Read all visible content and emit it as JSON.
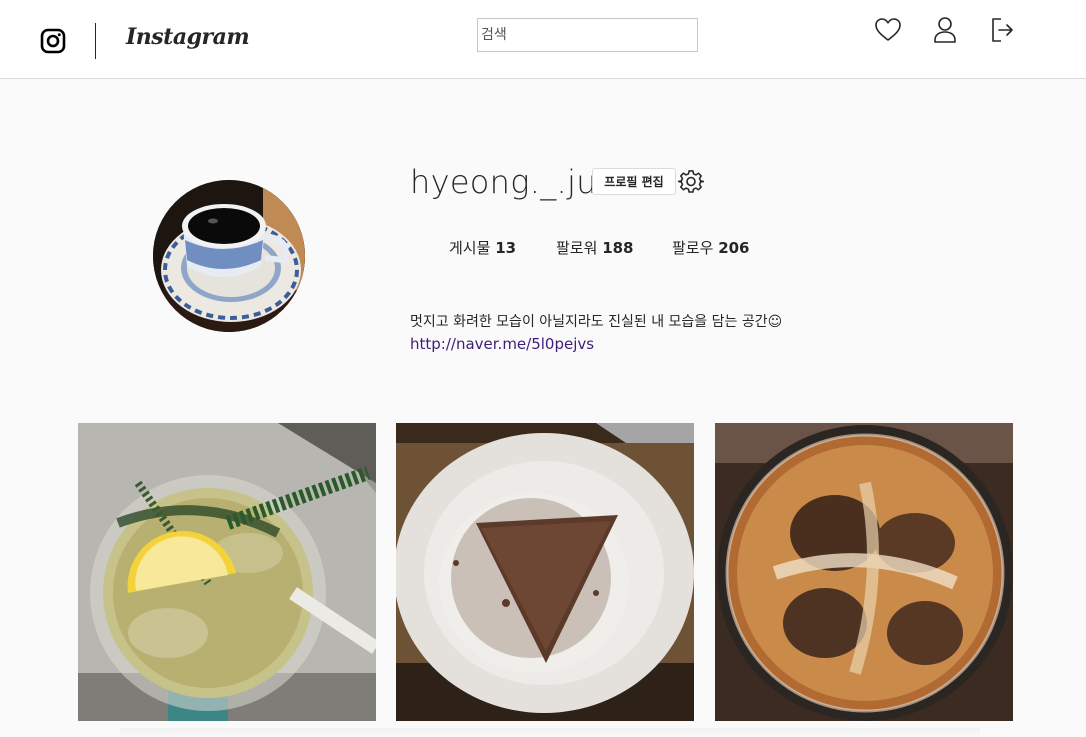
{
  "header": {
    "brand": "Instagram",
    "search": {
      "placeholder": "검색",
      "value": ""
    },
    "icons": [
      "instagram-logo-icon",
      "heart-icon",
      "person-icon",
      "logout-icon"
    ]
  },
  "profile": {
    "username": "hyeong._.ju",
    "edit_label": "프로필 편집",
    "stats": [
      {
        "label": "게시물",
        "value": "13"
      },
      {
        "label": "팔로워",
        "value": "188"
      },
      {
        "label": "팔로우",
        "value": "206"
      }
    ],
    "bio": "멋지고 화려한 모습이 아닐지라도 진실된 내 모습을 담는 공간☺",
    "link": "http://naver.me/5l0pejvs"
  },
  "posts": [
    "lemonade-drink",
    "chocolate-cake",
    "iced-coffee"
  ],
  "colors": {
    "link": "#3f1d7a",
    "border": "#dbdbdb",
    "background": "#fafafa"
  }
}
